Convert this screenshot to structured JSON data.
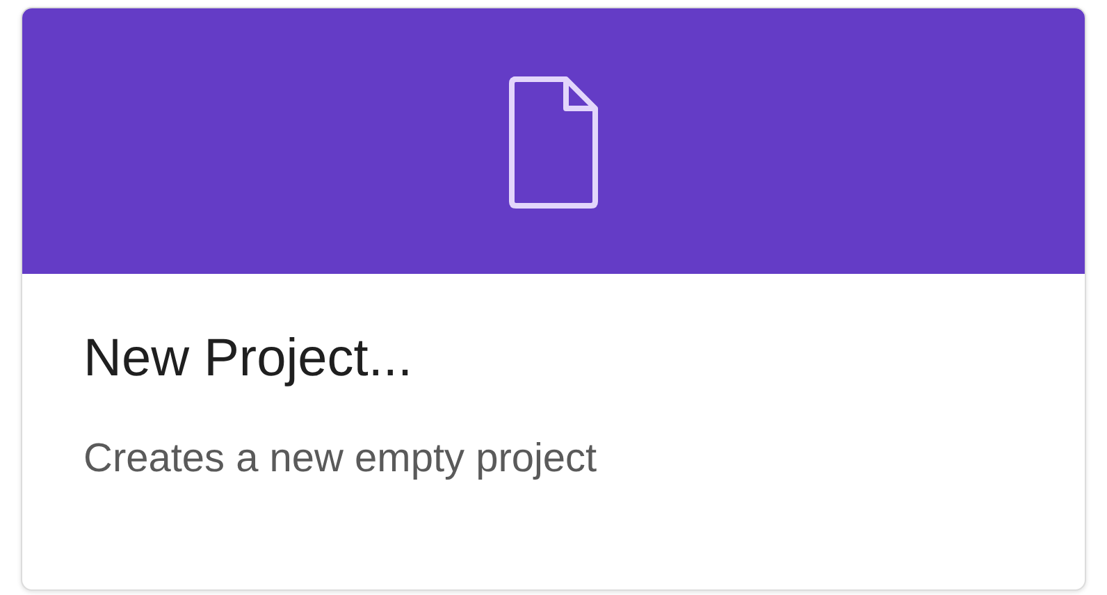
{
  "card": {
    "title": "New Project...",
    "description": "Creates a new empty project"
  }
}
